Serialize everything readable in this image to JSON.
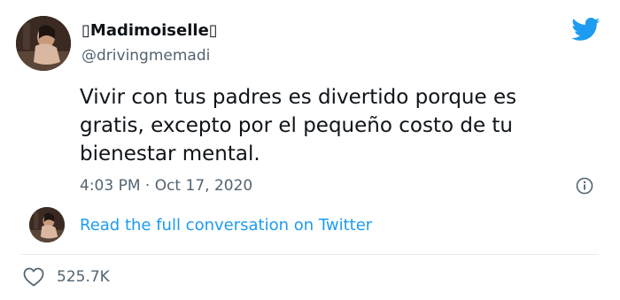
{
  "author": {
    "name": "▯Madimoiselle▯",
    "handle": "@drivingmemadi",
    "avatar_icon": "profile-photo"
  },
  "tweet": {
    "text_lines": [
      "Vivir con tus padres es divertido porque es",
      "gratis, excepto por el pequeño costo de tu",
      "bienestar mental."
    ],
    "timestamp": "4:03 PM · Oct 17, 2020"
  },
  "conversation_link": "Read the full conversation on Twitter",
  "engagement": {
    "likes": "525.7K",
    "like_icon": "heart-icon"
  },
  "icons": {
    "brand": "twitter-bird-icon",
    "info": "info-icon"
  },
  "colors": {
    "brand_blue": "#1d9bf0",
    "text_primary": "#0f1419",
    "text_secondary": "#536471",
    "divider": "#e6ecf0"
  }
}
